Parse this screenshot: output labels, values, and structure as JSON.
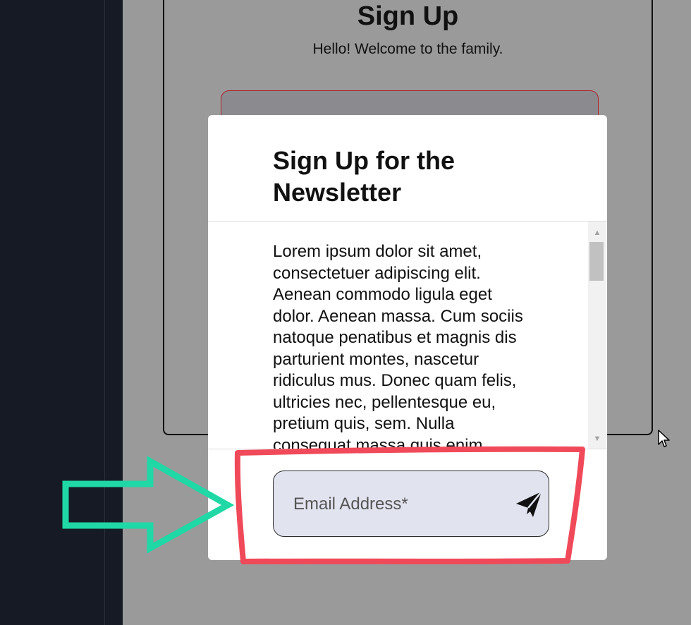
{
  "background_form": {
    "title": "Sign Up",
    "subtitle": "Hello! Welcome to the family."
  },
  "modal": {
    "title": "Sign Up for the Newsletter",
    "body": "Lorem ipsum dolor sit amet, consectetuer adipiscing elit. Aenean commodo ligula eget dolor. Aenean massa. Cum sociis natoque penatibus et magnis dis parturient montes, nascetur ridiculus mus. Donec quam felis, ultricies nec, pellentesque eu, pretium quis, sem. Nulla consequat massa quis enim.",
    "email": {
      "placeholder": "Email Address*",
      "value": ""
    },
    "send_icon": "paper-plane-icon"
  },
  "annotations": {
    "highlight_color": "#f04a5a",
    "arrow_color": "#1fd8a6"
  },
  "colors": {
    "page_background": "#9a9a9a",
    "sidebar_background": "#161a24",
    "email_field_background": "#e1e3ef"
  }
}
